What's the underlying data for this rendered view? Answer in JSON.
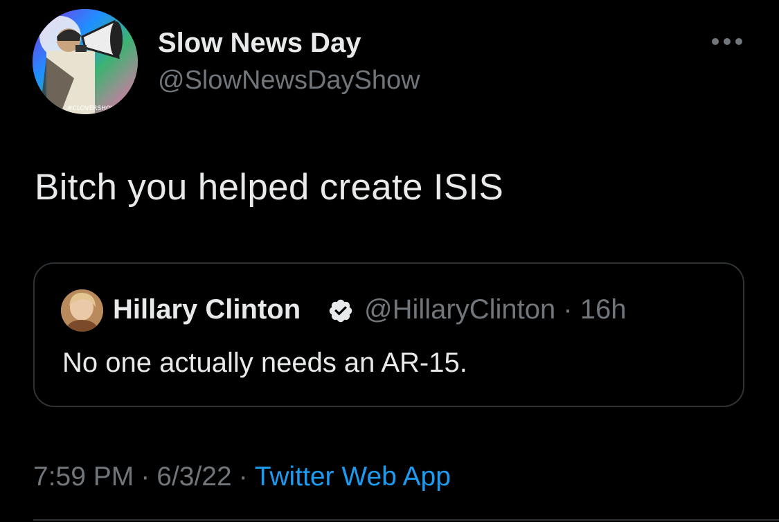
{
  "author": {
    "display_name": "Slow News Day",
    "handle": "@SlowNewsDayShow"
  },
  "tweet": {
    "text": "Bitch you helped create ISIS"
  },
  "quoted_tweet": {
    "display_name": "Hillary Clinton",
    "handle_time": "@HillaryClinton · 16h",
    "verified": true,
    "text": "No one actually needs an AR-15."
  },
  "meta": {
    "time": "7:59 PM",
    "separator": "·",
    "date": "6/3/22",
    "source": "Twitter Web App"
  },
  "colors": {
    "background": "#000000",
    "primary_text": "#e7e9ea",
    "secondary_text": "#71767b",
    "link": "#1d9bf0",
    "border": "#2f3336"
  },
  "icons": {
    "more": "more-horizontal-icon",
    "verified": "verified-badge-icon"
  }
}
